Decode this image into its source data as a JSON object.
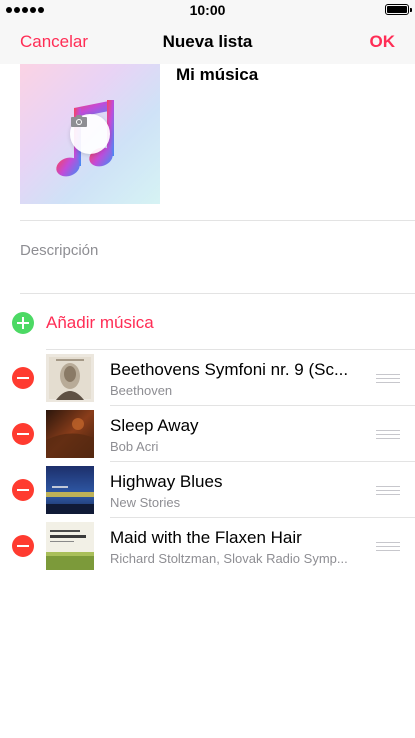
{
  "status_bar": {
    "time": "10:00",
    "battery_level": 1.0
  },
  "nav": {
    "cancel_label": "Cancelar",
    "title": "Nueva lista",
    "ok_label": "OK"
  },
  "playlist": {
    "title": "Mi música",
    "description_placeholder": "Descripción",
    "artwork_icon": "music-note-icon",
    "camera_icon": "camera-icon"
  },
  "add_music": {
    "label": "Añadir música",
    "icon": "plus-circle-icon"
  },
  "tracks": [
    {
      "title": "Beethovens Symfoni nr. 9 (Sc...",
      "artist": "Beethoven"
    },
    {
      "title": "Sleep Away",
      "artist": "Bob Acri"
    },
    {
      "title": "Highway Blues",
      "artist": "New Stories"
    },
    {
      "title": "Maid with the Flaxen Hair",
      "artist": "Richard Stoltzman, Slovak Radio Symp..."
    }
  ],
  "colors": {
    "accent": "#ff2d55",
    "add": "#4cd964",
    "delete": "#ff3b30",
    "secondary_text": "#8e8e93"
  }
}
